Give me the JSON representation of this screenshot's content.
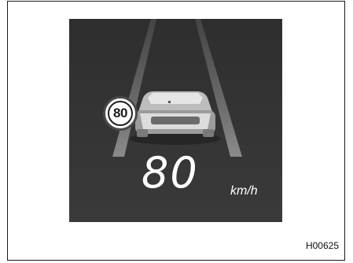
{
  "display": {
    "speed_limit_sign": "80",
    "current_speed": "80",
    "speed_unit": "km/h"
  },
  "figure_code": "H00625",
  "colors": {
    "display_background": "#2e2e2e",
    "text": "#ffffff",
    "sign_fill": "#ffffff"
  }
}
